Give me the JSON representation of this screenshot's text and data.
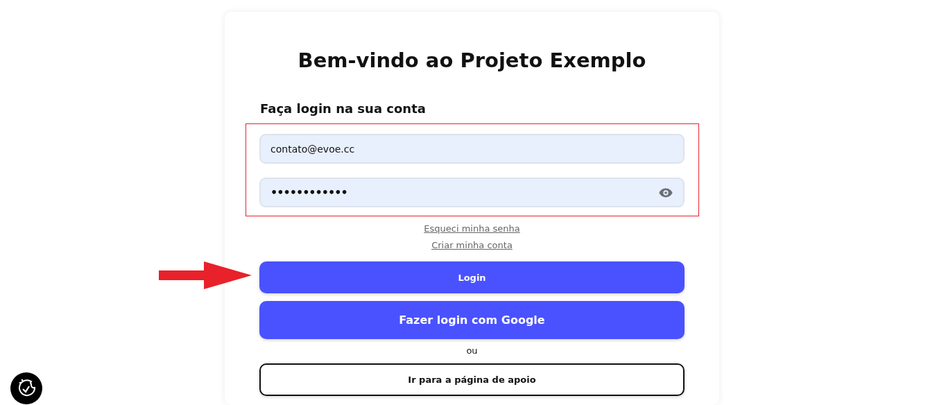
{
  "title": "Bem-vindo ao Projeto Exemplo",
  "subtitle": "Faça login na sua conta",
  "fields": [
    {
      "kind": "email",
      "value": "contato@evoe.cc"
    },
    {
      "kind": "password",
      "value": "••••••••••••"
    }
  ],
  "links": [
    "Esqueci minha senha",
    "Criar minha conta"
  ],
  "buttons": [
    {
      "kind": "primary",
      "label": "Login"
    },
    {
      "kind": "primary-large",
      "label": "Fazer login com Google"
    },
    {
      "kind": "separator",
      "label": "ou"
    },
    {
      "kind": "outline",
      "label": "Ir para a página de apoio"
    }
  ]
}
